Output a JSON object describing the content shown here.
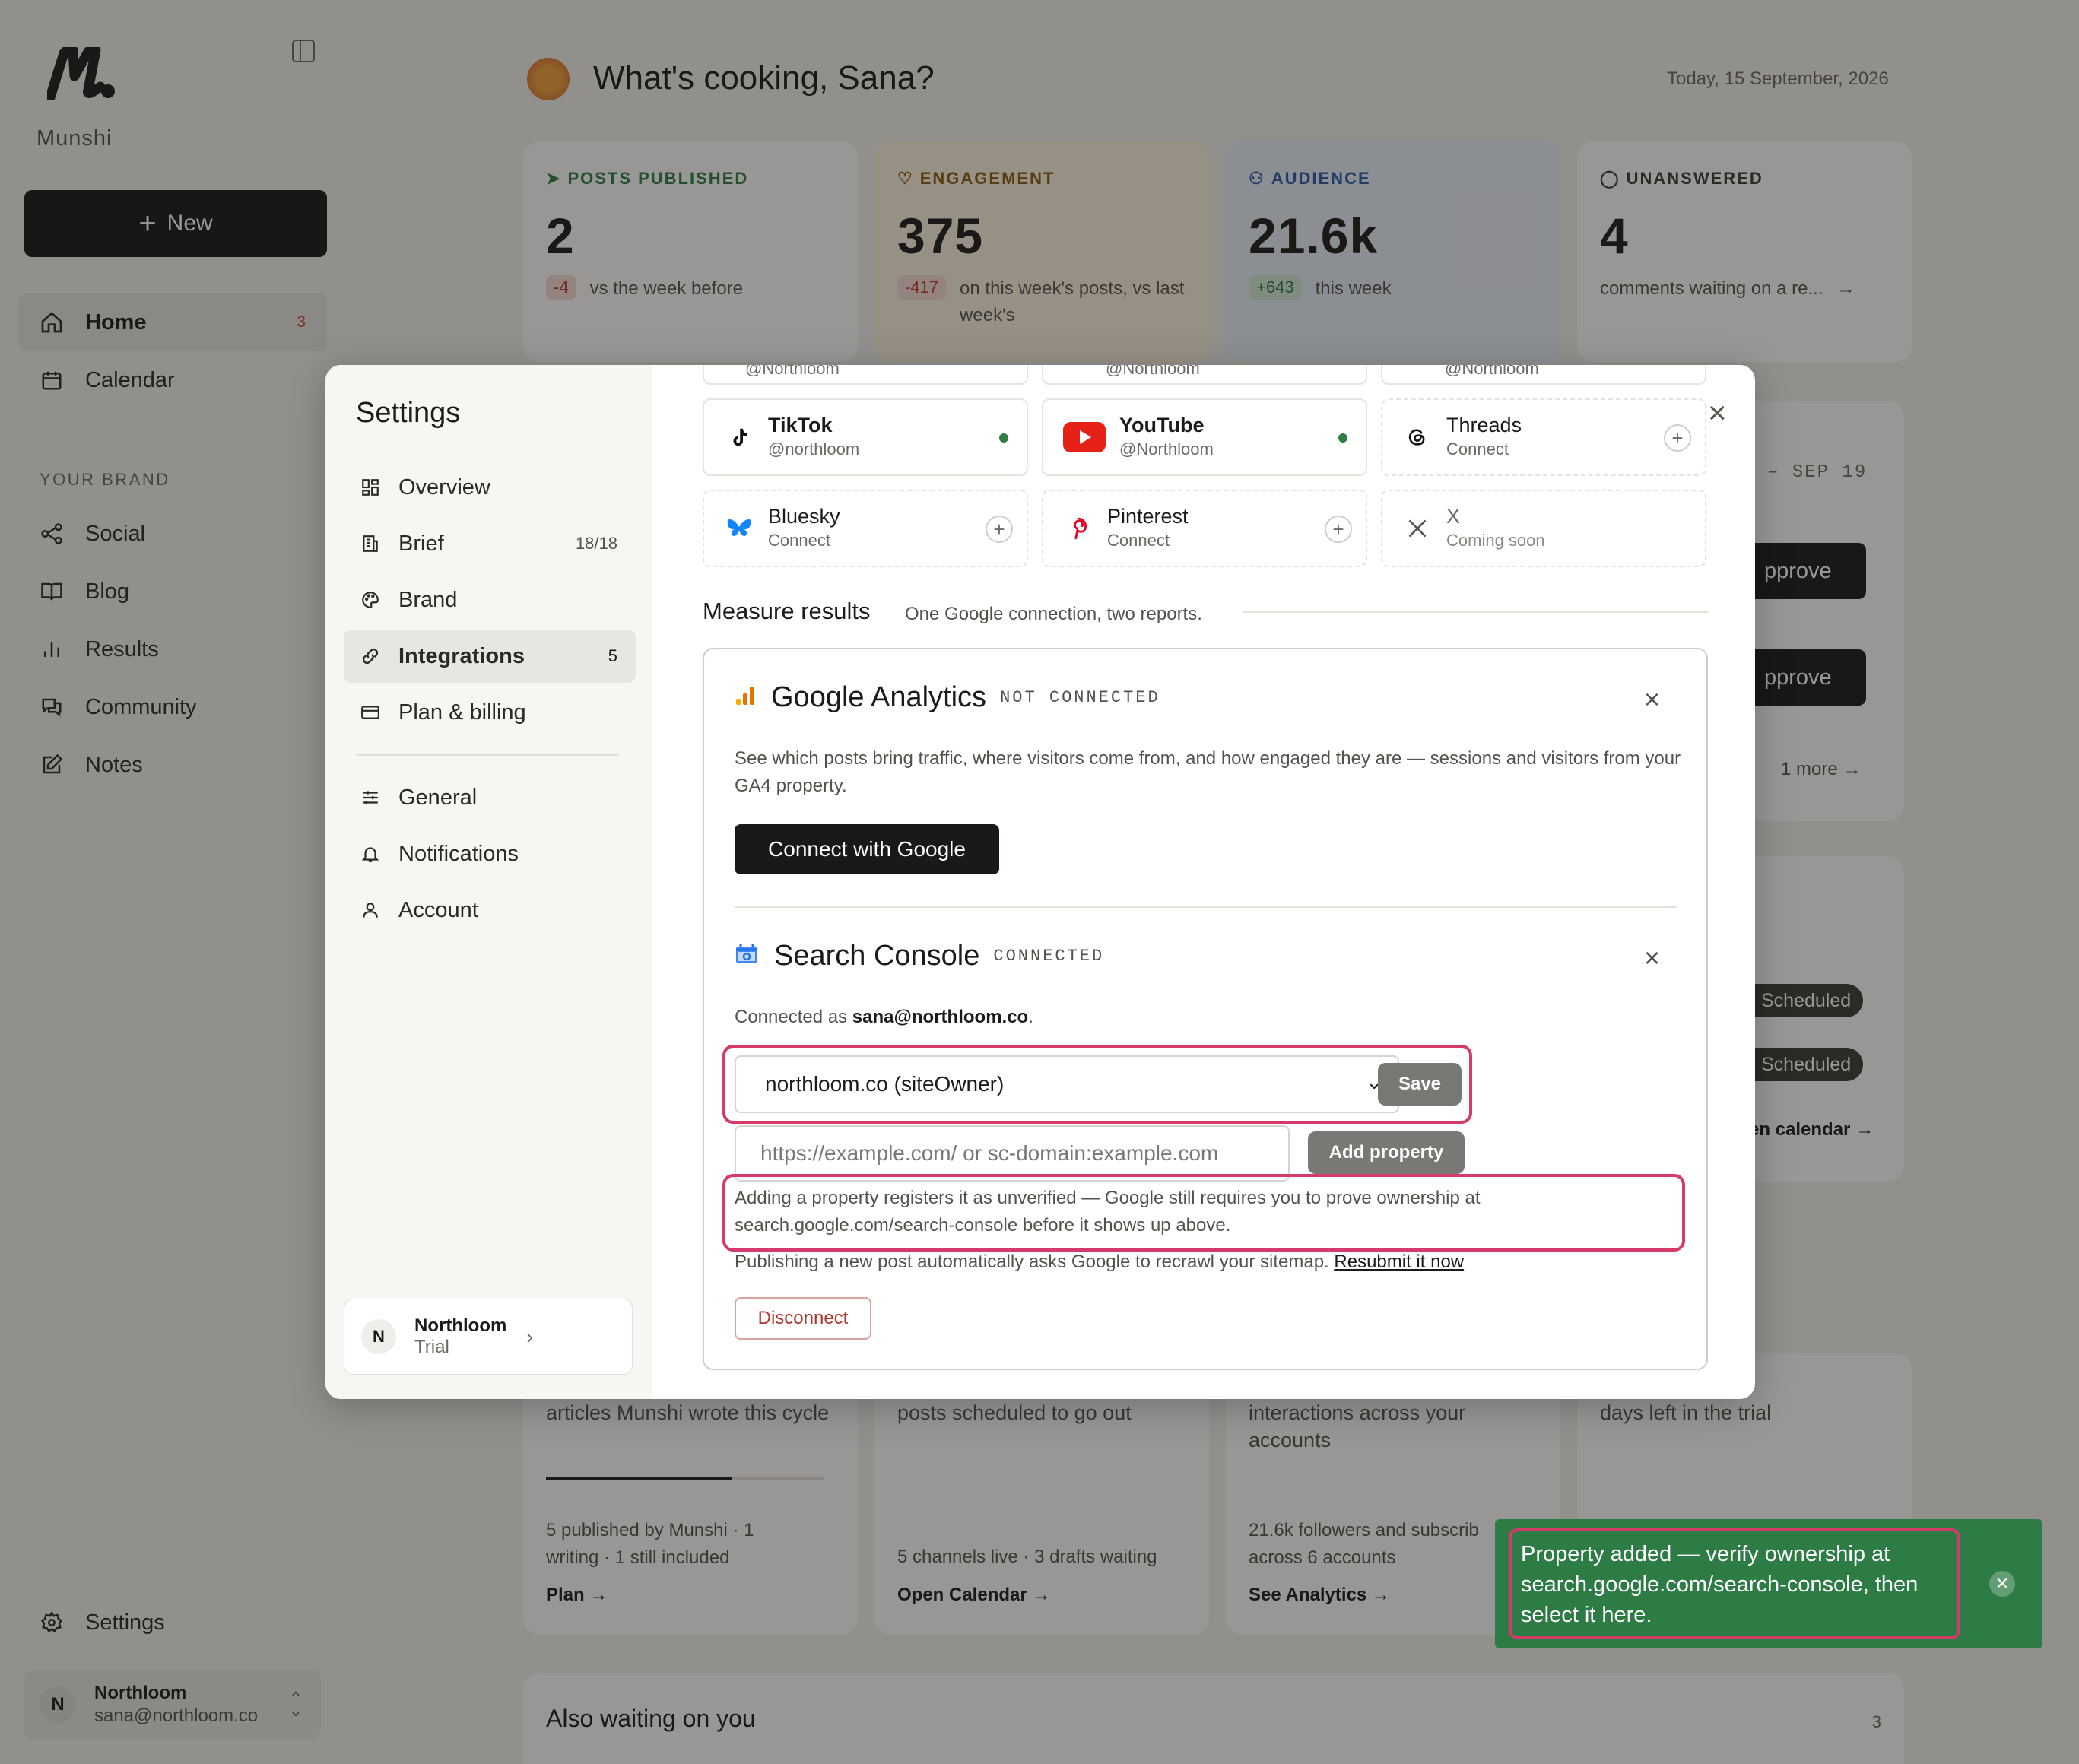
{
  "sidebar": {
    "brand": "Munshi",
    "new_button": "New",
    "nav": [
      {
        "label": "Home",
        "badge": "3",
        "icon": "home-icon"
      },
      {
        "label": "Calendar",
        "icon": "calendar-icon"
      }
    ],
    "section_title": "YOUR BRAND",
    "brand_nav": [
      {
        "label": "Social",
        "icon": "share-icon"
      },
      {
        "label": "Blog",
        "icon": "book-icon"
      },
      {
        "label": "Results",
        "icon": "bar-chart-icon"
      },
      {
        "label": "Community",
        "icon": "chat-icon"
      },
      {
        "label": "Notes",
        "icon": "edit-icon"
      }
    ],
    "settings_label": "Settings",
    "user": {
      "initial": "N",
      "name": "Northloom",
      "email": "sana@northloom.co"
    }
  },
  "header": {
    "greeting": "What's cooking, Sana?",
    "date": "Today, 15 September, 2026"
  },
  "stats": [
    {
      "label": "POSTS PUBLISHED",
      "value": "2",
      "delta": "-4",
      "note": "vs the week before",
      "color": "#2f7d44"
    },
    {
      "label": "ENGAGEMENT",
      "value": "375",
      "delta": "-417",
      "note": "on this week's posts, vs last week's",
      "color": "#8a5a10"
    },
    {
      "label": "AUDIENCE",
      "value": "21.6k",
      "delta": "+643",
      "note": "this week",
      "color": "#2a5aa8"
    },
    {
      "label": "UNANSWERED",
      "value": "4",
      "note": "comments waiting on a re...",
      "color": "#3a3936"
    }
  ],
  "background_right": {
    "date_range": "– SEP 19",
    "approve_1": "pprove",
    "approve_2": "pprove",
    "more": "1 more",
    "scheduled_1": "Scheduled",
    "scheduled_2": "Scheduled",
    "calendar_link": "en calendar →"
  },
  "bottom_cards": [
    {
      "text": "articles Munshi wrote this cycle",
      "sub": "5 published by Munshi · 1 writing · 1 still included",
      "link": "Plan →",
      "progress": 0.67
    },
    {
      "text": "posts scheduled to go out",
      "sub": "5 channels live · 3 drafts waiting",
      "link": "Open Calendar →"
    },
    {
      "text": "interactions across your accounts",
      "sub": "21.6k followers and subscrib across 6 accounts",
      "link": "See Analytics →"
    },
    {
      "text": "days left in the trial"
    }
  ],
  "also_waiting": {
    "title": "Also waiting on you",
    "count": "3"
  },
  "settings_modal": {
    "title": "Settings",
    "nav": [
      {
        "label": "Overview",
        "icon": "grid-icon"
      },
      {
        "label": "Brief",
        "count": "18/18",
        "icon": "building-icon"
      },
      {
        "label": "Brand",
        "icon": "palette-icon"
      },
      {
        "label": "Integrations",
        "count": "5",
        "icon": "link-icon",
        "active": true
      },
      {
        "label": "Plan & billing",
        "icon": "card-icon"
      }
    ],
    "nav2": [
      {
        "label": "General",
        "icon": "sliders-icon"
      },
      {
        "label": "Notifications",
        "icon": "bell-icon"
      },
      {
        "label": "Account",
        "icon": "user-icon"
      }
    ],
    "workspace": {
      "initial": "N",
      "name": "Northloom",
      "plan": "Trial"
    },
    "clipped_row": [
      "@Northloom",
      "@Northloom",
      "@Northloom"
    ],
    "integrations": [
      {
        "name": "TikTok",
        "sub": "@northloom",
        "state": "connected"
      },
      {
        "name": "YouTube",
        "sub": "@Northloom",
        "state": "connected"
      },
      {
        "name": "Threads",
        "sub": "Connect",
        "state": "add"
      },
      {
        "name": "Bluesky",
        "sub": "Connect",
        "state": "add"
      },
      {
        "name": "Pinterest",
        "sub": "Connect",
        "state": "add"
      },
      {
        "name": "X",
        "sub": "Coming soon",
        "state": "soon"
      }
    ],
    "measure": {
      "title": "Measure results",
      "subtitle": "One Google connection, two reports.",
      "analytics": {
        "name": "Google Analytics",
        "status": "NOT CONNECTED",
        "description": "See which posts bring traffic, where visitors come from, and how engaged they are — sessions and visitors from your GA4 property.",
        "button": "Connect with Google"
      },
      "search_console": {
        "name": "Search Console",
        "status": "CONNECTED",
        "connected_prefix": "Connected as",
        "email": "sana@northloom.co",
        "property_selected": "northloom.co (siteOwner)",
        "save": "Save",
        "add_placeholder": "https://example.com/ or sc-domain:example.com",
        "add_button": "Add property",
        "note": "Adding a property registers it as unverified — Google still requires you to prove ownership at search.google.com/search-console before it shows up above.",
        "recrawl": "Publishing a new post automatically asks Google to recrawl your sitemap.",
        "resubmit": "Resubmit it now",
        "disconnect": "Disconnect"
      }
    }
  },
  "toast": {
    "message": "Property added — verify ownership at search.google.com/search-console, then select it here.",
    "color": "#2e7c45"
  }
}
